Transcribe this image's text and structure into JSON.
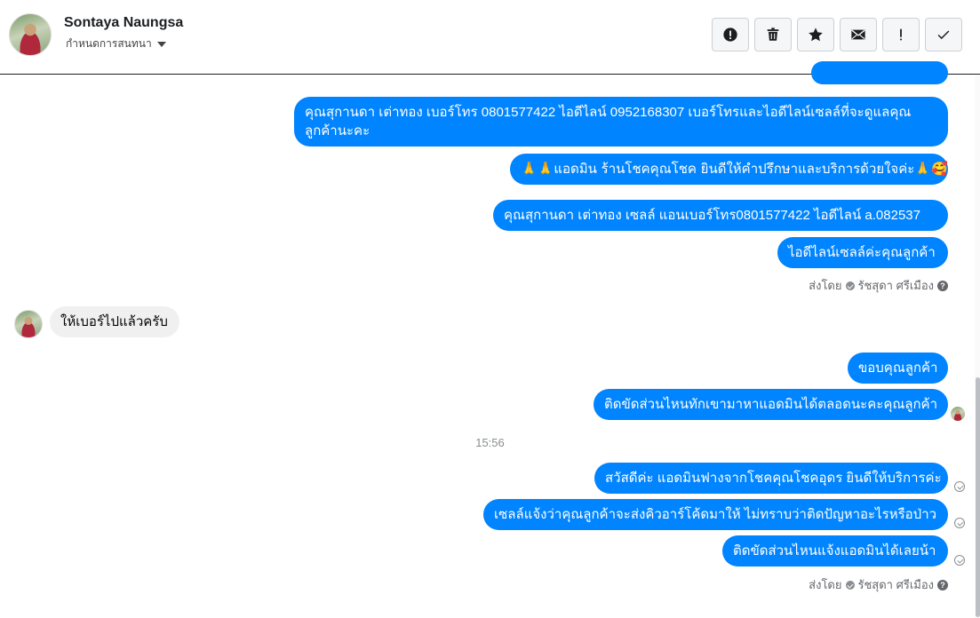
{
  "contact": {
    "name": "Sontaya Naungsa",
    "subtitle": "กำหนดการสนทนา"
  },
  "toolbar": [
    {
      "icon": "alert-circle-icon",
      "label": "!"
    },
    {
      "icon": "trash-icon"
    },
    {
      "icon": "star-icon"
    },
    {
      "icon": "mail-icon"
    },
    {
      "icon": "exclamation-icon",
      "label": "!"
    },
    {
      "icon": "check-icon"
    }
  ],
  "messages": {
    "m1": "คุณสุกานดา เต่าทอง      เบอร์โทร 0801577422  ไอดีไลน์ 0952168307   เบอร์โทรและไอดีไลน์เซลล์ที่จะดูแลคุณลูกค้านะคะ",
    "m2": "🙏🙏แอดมิน ร้านโชคคุณโชค ยินดีให้คำปรึกษาและบริการด้วยใจค่ะ🙏🥰",
    "m3": "คุณสุกานดา เต่าทอง  เซลล์ แอนเบอร์โทร0801577422 ไอดีไลน์ a.082537",
    "m4": "ไอดีไลน์เซลล์ค่ะคุณลูกค้า",
    "m5": "ให้เบอร์ไปแล้วครับ",
    "m6": "ขอบคุณลูกค้า",
    "m7": "ติดขัดส่วนไหนทักเขามาหาแอดมินได้ตลอดนะคะคุณลูกค้า",
    "m8": "สวัสดีค่ะ แอดมินฟางจากโชคคุณโชคอุดร ยินดีให้บริการค่ะ",
    "m9": "เซลล์แจ้งว่าคุณลูกค้าจะส่งคิวอาร์โค้ดมาให้  ไม่ทราบว่าติดปัญหาอะไรหรือป่าว",
    "m10": "ติดขัดส่วนไหนแจ้งแอดมินได้เลยน้า"
  },
  "sent_by": {
    "prefix": "ส่งโดย",
    "name": "รัชสุดา ศรีเมือง"
  },
  "timestamp": "15:56",
  "colors": {
    "outgoing_bubble": "#0084ff",
    "incoming_bubble": "#f0f0f0"
  }
}
